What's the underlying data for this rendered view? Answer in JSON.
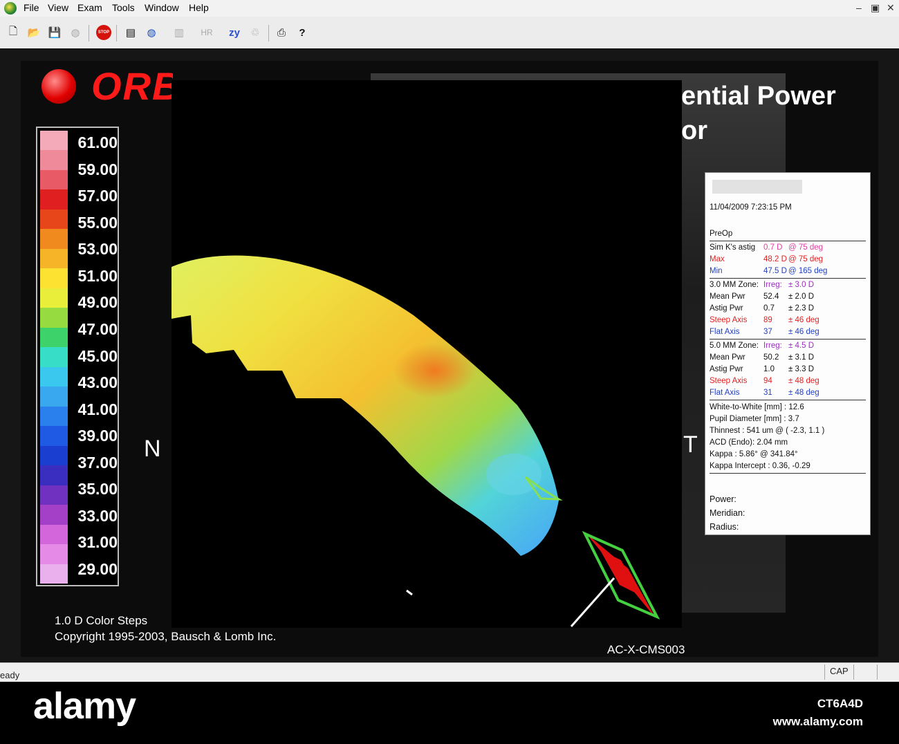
{
  "menu": [
    "File",
    "View",
    "Exam",
    "Tools",
    "Window",
    "Help"
  ],
  "window_controls": [
    "–",
    "▣",
    "✕"
  ],
  "toolbar": {
    "new": "🗋",
    "open": "📂",
    "save": "💾",
    "globe": "◍",
    "stop": "STOP",
    "list": "▤",
    "map": "◍",
    "doc": "▥",
    "hr": "HR",
    "zy": "zy",
    "recycle": "♲",
    "print": "⎙",
    "help": "?"
  },
  "header": {
    "logo_text": "ORBSCAN",
    "title": "ential Power",
    "subtitle": "or"
  },
  "scale": {
    "labels": [
      "61.00",
      "59.00",
      "57.00",
      "55.00",
      "53.00",
      "51.00",
      "49.00",
      "47.00",
      "45.00",
      "43.00",
      "41.00",
      "39.00",
      "37.00",
      "35.00",
      "33.00",
      "31.00",
      "29.00"
    ],
    "colors": [
      "#f4aab9",
      "#ee8a9a",
      "#e85a65",
      "#e02020",
      "#e6461a",
      "#f08a1e",
      "#f6b528",
      "#fde231",
      "#e8ee3a",
      "#96dc41",
      "#3dd36a",
      "#38ddc8",
      "#3ac8ee",
      "#3aa8ee",
      "#2a80ec",
      "#1e5ae4",
      "#1a3fd0",
      "#3a2ec0",
      "#7030c0",
      "#a440c8",
      "#d466dc",
      "#e68ae8",
      "#eab0ee"
    ]
  },
  "map": {
    "nasal_label": "N",
    "temporal_label": "T"
  },
  "info": {
    "datetime": "11/04/2009 7:23:15 PM",
    "preop": "PreOp",
    "simk": {
      "label": "Sim K's astig",
      "val": "0.7 D",
      "deg": "@ 75 deg"
    },
    "max": {
      "label": "Max",
      "val": "48.2 D",
      "deg": "@ 75 deg"
    },
    "min": {
      "label": "Min",
      "val": "47.5 D",
      "deg": "@ 165 deg"
    },
    "zone3": {
      "title": "3.0 MM Zone:",
      "irreg_label": "Irreg:",
      "irreg_val": "± 3.0 D",
      "mean_label": "Mean Pwr",
      "mean_val": "52.4",
      "mean_tol": "± 2.0 D",
      "astig_label": "Astig Pwr",
      "astig_val": "0.7",
      "astig_tol": "± 2.3 D",
      "steep_label": "Steep Axis",
      "steep_val": "89",
      "steep_tol": "± 46 deg",
      "flat_label": "Flat Axis",
      "flat_val": "37",
      "flat_tol": "± 46 deg"
    },
    "zone5": {
      "title": "5.0 MM Zone:",
      "irreg_label": "Irreg:",
      "irreg_val": "± 4.5 D",
      "mean_label": "Mean Pwr",
      "mean_val": "50.2",
      "mean_tol": "± 3.1 D",
      "astig_label": "Astig Pwr",
      "astig_val": "1.0",
      "astig_tol": "± 3.3 D",
      "steep_label": "Steep Axis",
      "steep_val": "94",
      "steep_tol": "± 48 deg",
      "flat_label": "Flat Axis",
      "flat_val": "31",
      "flat_tol": "± 48 deg"
    },
    "wtw": "White-to-White [mm] : 12.6",
    "pupil": "Pupil Diameter [mm] : 3.7",
    "thinnest": "Thinnest : 541 um @ ( -2.3, 1.1 )",
    "acd": "ACD (Endo): 2.04 mm",
    "kappa": "Kappa : 5.86° @ 341.84°",
    "kappa_int": "Kappa Intercept : 0.36, -0.29",
    "power": "Power:",
    "meridian": "Meridian:",
    "radius": "Radius:"
  },
  "footer": {
    "color_steps": "1.0 D Color Steps",
    "copyright": "Copyright 1995-2003, Bausch & Lomb Inc.",
    "exam_id": "AC-X-CMS003"
  },
  "status": {
    "text": "eady",
    "cap": "CAP"
  },
  "stock": {
    "logo": "alamy",
    "image_id": "CT6A4D",
    "url": "www.alamy.com"
  }
}
